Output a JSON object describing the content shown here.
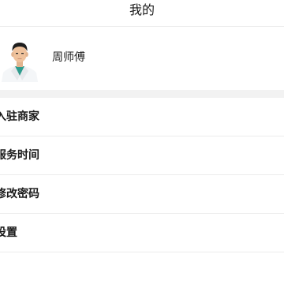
{
  "header": {
    "title": "我的"
  },
  "profile": {
    "name": "周师傅",
    "avatar_icon": "doctor-avatar"
  },
  "menu": {
    "items": [
      {
        "label": "入驻商家"
      },
      {
        "label": "服务时间"
      },
      {
        "label": "修改密码"
      },
      {
        "label": "设置"
      }
    ]
  }
}
